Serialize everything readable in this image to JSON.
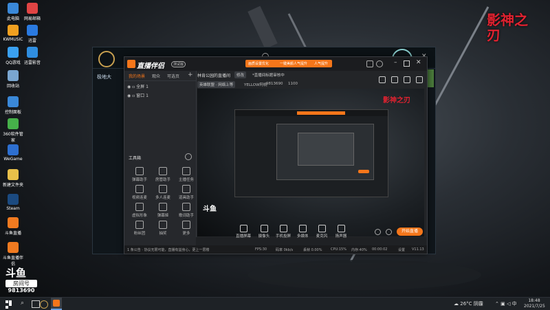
{
  "desktop": {
    "icons": [
      {
        "label": "此电脑",
        "color": "#3a88d8"
      },
      {
        "label": "网易邮箱",
        "color": "#e04444"
      },
      {
        "label": "KWMUSIC",
        "color": "#f0a020"
      },
      {
        "label": "迅雷",
        "color": "#2a7ae0"
      },
      {
        "label": "QQ游戏",
        "color": "#3aa0f0"
      },
      {
        "label": "迅雷影音",
        "color": "#2f8ee0"
      },
      {
        "label": "回收站",
        "color": "#7aa6d0"
      },
      {
        "label": "控制面板",
        "color": "#3a88d8"
      },
      {
        "label": "360软件管家",
        "color": "#46b04a"
      },
      {
        "label": "WeGame",
        "color": "#2d6fd0"
      },
      {
        "label": "新建文件夹",
        "color": "#e8c04a"
      },
      {
        "label": "Steam",
        "color": "#1b4a80"
      },
      {
        "label": "斗鱼直播",
        "color": "#f07a20"
      },
      {
        "label": "斗鱼直播伴侣",
        "color": "#f07a20"
      }
    ],
    "watermark": {
      "logo": "斗鱼",
      "room_label": "房间号",
      "room_number": "9813690"
    },
    "brand_logo": "影神之刃"
  },
  "taskbar": {
    "weather": "26°C 阴霾",
    "time": "18:48",
    "date": "2021/7/25",
    "ime": "中"
  },
  "background_window": {
    "title": "极地大"
  },
  "app": {
    "logo_text": "直播伴侣",
    "version_badge": "测试版",
    "left_tabs": [
      "我的场景",
      "观众",
      "可选页"
    ],
    "scenes": [
      {
        "label": "全屏 1"
      },
      {
        "label": "窗口 1"
      }
    ],
    "toolbox_title": "工具箱",
    "tools": [
      {
        "label": "弹幕助手"
      },
      {
        "label": "房管助手"
      },
      {
        "label": "主播任务"
      },
      {
        "label": "视频连麦"
      },
      {
        "label": "多人连麦"
      },
      {
        "label": "道具助手"
      },
      {
        "label": "虚拟形象"
      },
      {
        "label": "弹幕姬"
      },
      {
        "label": "歌词助手"
      },
      {
        "label": "粉丝团"
      },
      {
        "label": "抽奖"
      },
      {
        "label": "更多"
      }
    ],
    "room_title": "林肯公园的直播间",
    "edit_label": "修改",
    "notice": "*直播间标题审核中",
    "category": "英雄联盟 · 网络上等",
    "streamer": "YELLOW阿桃",
    "room_id": "9813690",
    "heat": "1100",
    "banner_tabs": [
      "画质设置优化",
      "一键美颜人气提升",
      "人气提升"
    ],
    "bottom_buttons": [
      {
        "label": "直播屏幕"
      },
      {
        "label": "摄像头"
      },
      {
        "label": "手机投屏"
      },
      {
        "label": "多媒体"
      },
      {
        "label": "麦克风"
      },
      {
        "label": "扬声器"
      }
    ],
    "start_button": "开始直播",
    "status": {
      "message": "1 条公告 · 协议无限可能，直播有益身心，更上一层楼",
      "fps": "FPS:30",
      "bitrate": "码率 0kb/s",
      "drop": "丢帧 0.00%",
      "cpu": "CPU:15%",
      "mem": "内存:40%",
      "timer": "00:00:02",
      "settings": "设置",
      "version": "V11.13"
    }
  }
}
